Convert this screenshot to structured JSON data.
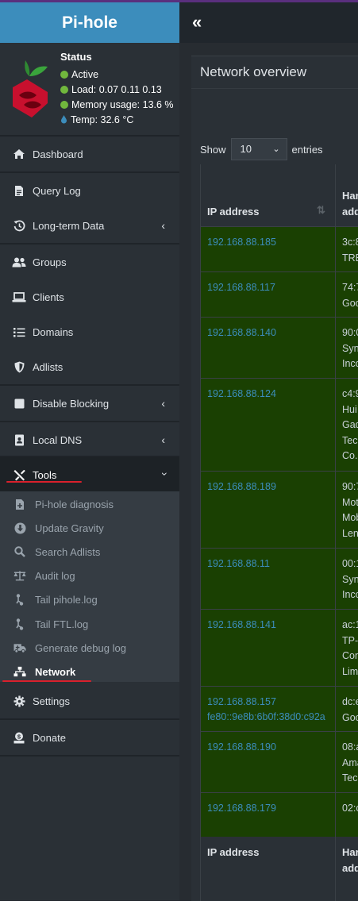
{
  "app": {
    "title": "Pi-hole",
    "collapse_icon": "«"
  },
  "status": {
    "title": "Status",
    "active": "Active",
    "load": "Load:  0.07  0.11  0.13",
    "memory": "Memory usage:  13.6 %",
    "temp": "Temp: 32.6 °C",
    "status_color": "#71b83d",
    "temp_icon_color": "#3c8dbc"
  },
  "nav": {
    "dashboard": "Dashboard",
    "query_log": "Query Log",
    "long_term": "Long-term Data",
    "groups": "Groups",
    "clients": "Clients",
    "domains": "Domains",
    "adlists": "Adlists",
    "disable_blocking": "Disable Blocking",
    "local_dns": "Local DNS",
    "tools": "Tools",
    "settings": "Settings",
    "donate": "Donate"
  },
  "tools_menu": {
    "diagnosis": "Pi-hole diagnosis",
    "gravity": "Update Gravity",
    "search": "Search Adlists",
    "audit": "Audit log",
    "tail_pihole": "Tail pihole.log",
    "tail_ftl": "Tail FTL.log",
    "debug": "Generate debug log",
    "network": "Network"
  },
  "main": {
    "title": "Network overview",
    "show": "Show",
    "entries_value": "10",
    "entries": "entries",
    "col_ip": "IP address",
    "col_hw_1": "Har",
    "col_hw_2": "add"
  },
  "rows": [
    {
      "ip": "192.168.88.185",
      "hw": [
        "3c:8",
        "TRE"
      ]
    },
    {
      "ip": "192.168.88.117",
      "hw": [
        "74:7",
        "Goo"
      ]
    },
    {
      "ip": "192.168.88.140",
      "hw": [
        "90:0",
        "Syn",
        "Inco"
      ]
    },
    {
      "ip": "192.168.88.124",
      "hw": [
        "c4:9",
        "Hui",
        "Gad",
        "Tec",
        "Co.,"
      ]
    },
    {
      "ip": "192.168.88.189",
      "hw": [
        "90:7",
        "Mot",
        "Mob",
        "Len"
      ]
    },
    {
      "ip": "192.168.88.11",
      "hw": [
        "00:1",
        "Syn",
        "Inco"
      ]
    },
    {
      "ip": "192.168.88.141",
      "hw": [
        "ac:1",
        "TP-",
        "Con",
        "Lim"
      ]
    },
    {
      "ip": "192.168.88.157\nfe80::9e8b:6b0f:38d0:c92a",
      "hw": [
        "dc:e",
        "Goo"
      ]
    },
    {
      "ip": "192.168.88.190",
      "hw": [
        "08:a",
        "Ama",
        "Tec"
      ]
    },
    {
      "ip": "192.168.88.179",
      "hw": [
        "02:c"
      ]
    }
  ],
  "colors": {
    "accent": "#3c8dbc",
    "row_bg": "#1a4002",
    "highlight": "#d9202c"
  }
}
